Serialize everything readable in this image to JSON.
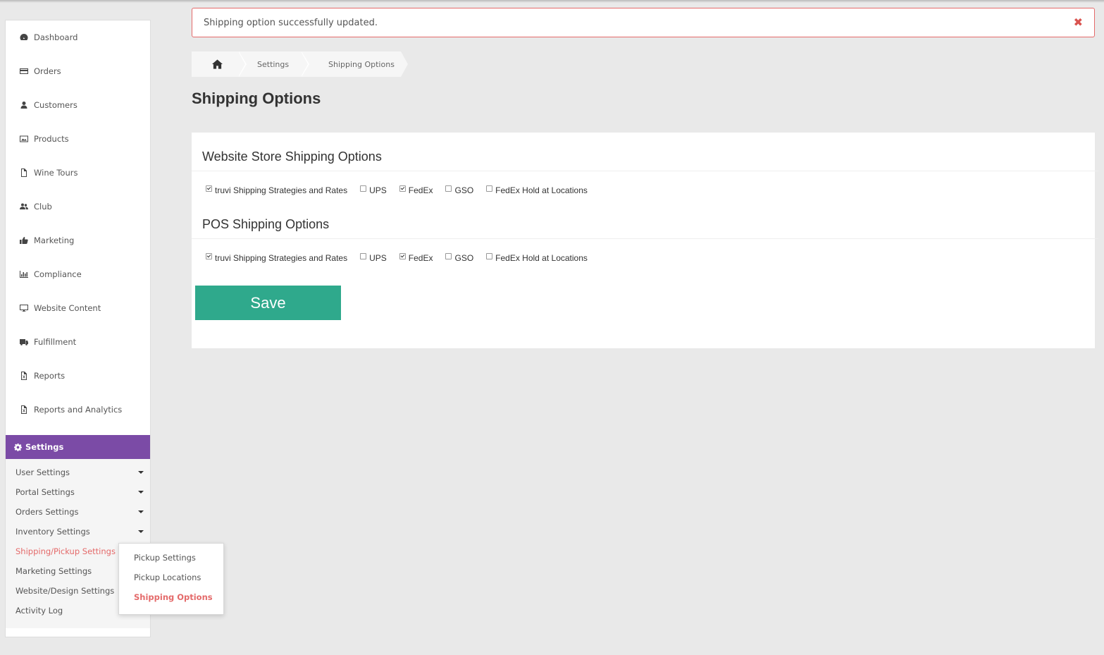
{
  "alert": {
    "message": "Shipping option successfully updated.",
    "close_glyph": "✖",
    "border_color": "#e46a6a"
  },
  "breadcrumb": {
    "home_icon": "home-icon",
    "items": [
      "Settings",
      "Shipping Options"
    ]
  },
  "page": {
    "title": "Shipping Options"
  },
  "sidebar": {
    "items": [
      {
        "label": "Dashboard",
        "icon": "dashboard-icon"
      },
      {
        "label": "Orders",
        "icon": "credit-card-icon"
      },
      {
        "label": "Customers",
        "icon": "user-icon"
      },
      {
        "label": "Products",
        "icon": "image-icon"
      },
      {
        "label": "Wine Tours",
        "icon": "file-icon"
      },
      {
        "label": "Club",
        "icon": "users-icon"
      },
      {
        "label": "Marketing",
        "icon": "thumbs-up-icon"
      },
      {
        "label": "Compliance",
        "icon": "bar-chart-icon"
      },
      {
        "label": "Website Content",
        "icon": "desktop-icon"
      },
      {
        "label": "Fulfillment",
        "icon": "truck-icon"
      },
      {
        "label": "Reports",
        "icon": "excel-file-icon"
      },
      {
        "label": "Reports and Analytics",
        "icon": "excel-file-icon"
      }
    ],
    "settings": {
      "label": "Settings",
      "icon": "gear-icon",
      "accent": "#7b4ba6",
      "sub_items": [
        {
          "label": "User Settings",
          "has_caret": true
        },
        {
          "label": "Portal Settings",
          "has_caret": true
        },
        {
          "label": "Orders Settings",
          "has_caret": true
        },
        {
          "label": "Inventory Settings",
          "has_caret": true
        },
        {
          "label": "Shipping/Pickup Settings",
          "has_caret": false,
          "active": true
        },
        {
          "label": "Marketing Settings",
          "has_caret": false
        },
        {
          "label": "Website/Design Settings",
          "has_caret": false
        },
        {
          "label": "Activity Log",
          "has_caret": false
        }
      ]
    }
  },
  "flyout": {
    "items": [
      {
        "label": "Pickup Settings"
      },
      {
        "label": "Pickup Locations"
      },
      {
        "label": "Shipping Options",
        "active": true
      }
    ]
  },
  "sections": [
    {
      "title": "Website Store Shipping Options",
      "options": [
        {
          "label": "truvi Shipping Strategies and Rates",
          "checked": true
        },
        {
          "label": "UPS",
          "checked": false
        },
        {
          "label": "FedEx",
          "checked": true
        },
        {
          "label": "GSO",
          "checked": false
        },
        {
          "label": "FedEx Hold at Locations",
          "checked": false
        }
      ]
    },
    {
      "title": "POS Shipping Options",
      "options": [
        {
          "label": "truvi Shipping Strategies and Rates",
          "checked": true
        },
        {
          "label": "UPS",
          "checked": false
        },
        {
          "label": "FedEx",
          "checked": true
        },
        {
          "label": "GSO",
          "checked": false
        },
        {
          "label": "FedEx Hold at Locations",
          "checked": false
        }
      ]
    }
  ],
  "save_button": {
    "label": "Save",
    "color": "#2fa98c"
  },
  "colors": {
    "active_link": "#e46a6a",
    "background": "#e9e9e9"
  }
}
